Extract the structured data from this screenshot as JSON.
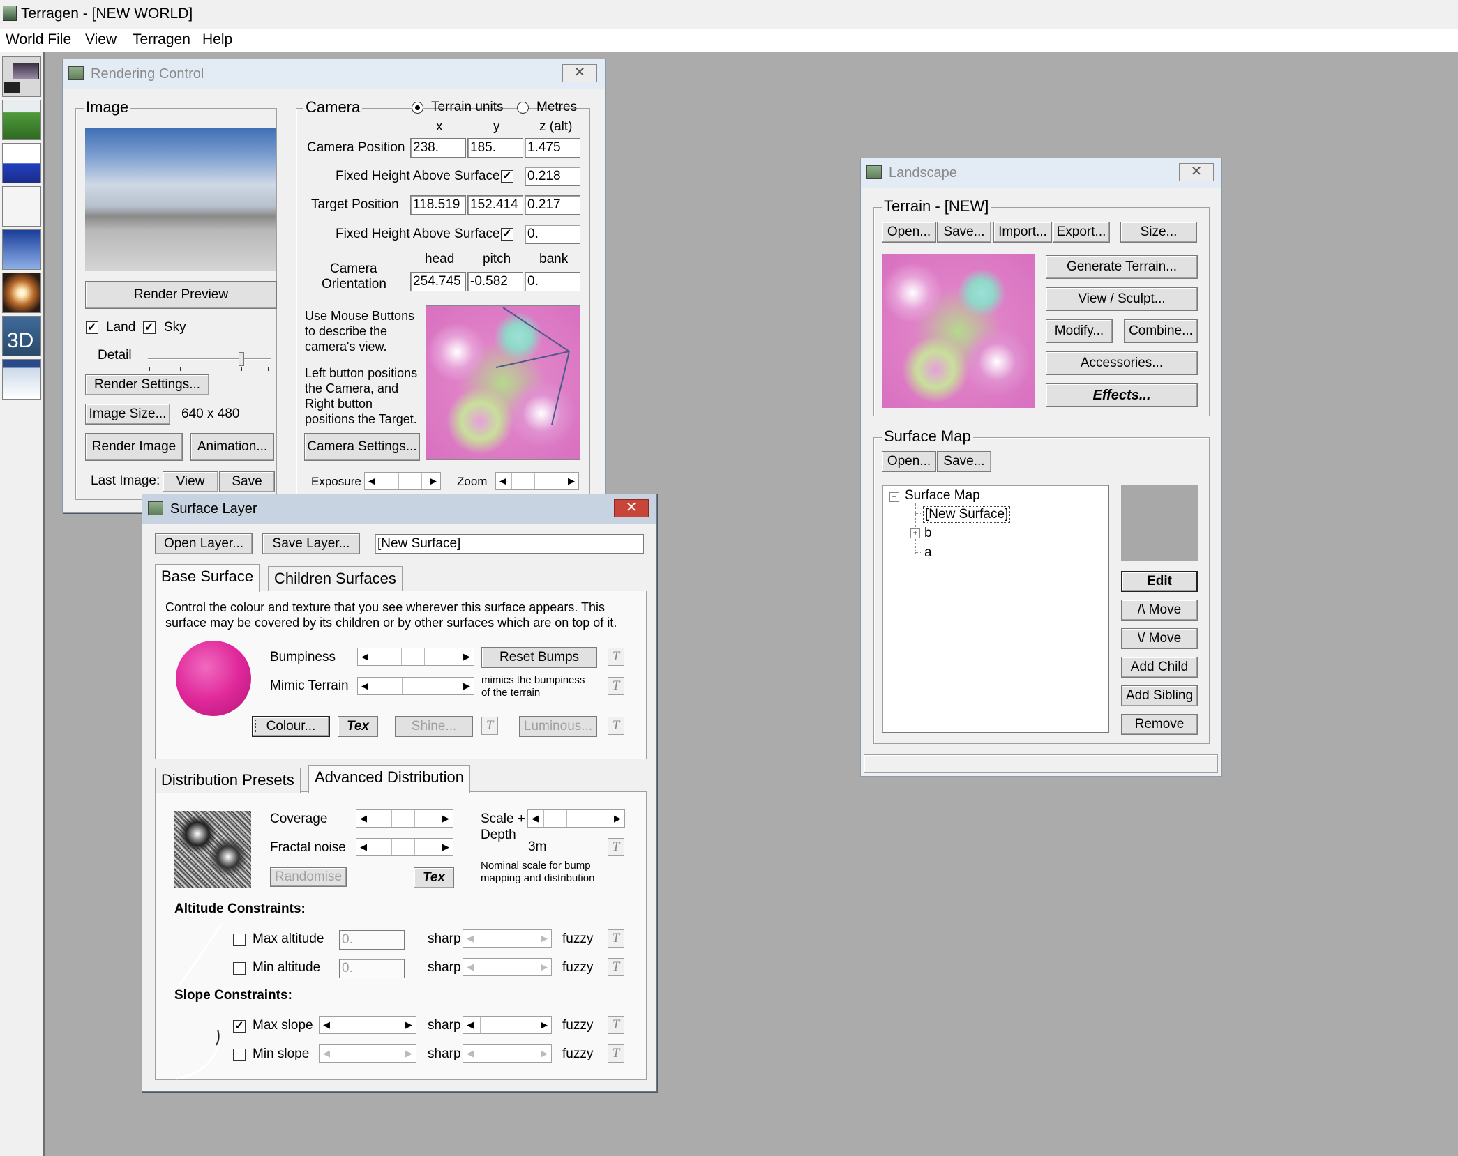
{
  "app": {
    "title": "Terragen  -  [NEW WORLD]"
  },
  "menu": [
    "World File",
    "View",
    "Terragen",
    "Help"
  ],
  "toolbar_icons": [
    "render-icon",
    "landscape-icon",
    "water-icon",
    "cloud-icon",
    "sky-icon",
    "sun-icon",
    "3d-icon",
    "image-icon"
  ],
  "rendering": {
    "title": "Rendering Control",
    "image_group": "Image",
    "render_preview": "Render Preview",
    "land": "Land",
    "sky": "Sky",
    "land_checked": true,
    "sky_checked": true,
    "detail": "Detail",
    "render_settings": "Render Settings...",
    "image_size": "Image Size...",
    "image_size_value": "640 x 480",
    "render_image": "Render Image",
    "animation": "Animation...",
    "last_image": "Last Image:",
    "view": "View",
    "save": "Save",
    "camera_group": "Camera",
    "terrain_units": "Terrain units",
    "metres": "Metres",
    "units_selected": "Terrain units",
    "col_x": "x",
    "col_y": "y",
    "col_z": "z (alt)",
    "camera_position": "Camera Position",
    "cam_x": "238.",
    "cam_y": "185.",
    "cam_z": "1.475",
    "fixed_height_1": "Fixed Height Above Surface",
    "fixed_height_1_value": "0.218",
    "target_position": "Target Position",
    "tgt_x": "118.519",
    "tgt_y": "152.414",
    "tgt_z": "0.217",
    "fixed_height_2": "Fixed Height Above Surface",
    "fixed_height_2_value": "0.",
    "head": "head",
    "pitch": "pitch",
    "bank": "bank",
    "camera_orientation_1": "Camera",
    "camera_orientation_2": "Orientation",
    "ori_head": "254.745",
    "ori_pitch": "-0.582",
    "ori_bank": "0.",
    "help1": [
      "Use Mouse Buttons",
      "to describe the",
      "camera's view."
    ],
    "help2": [
      "Left button positions",
      "the Camera, and",
      "Right button",
      "positions the Target."
    ],
    "camera_settings": "Camera Settings...",
    "exposure": "Exposure",
    "zoom": "Zoom"
  },
  "surface_layer": {
    "title": "Surface Layer",
    "open_layer": "Open Layer...",
    "save_layer": "Save Layer...",
    "name": "[New Surface]",
    "tab_base": "Base Surface",
    "tab_children": "Children Surfaces",
    "desc1": "Control the colour and texture that you see wherever this surface appears. This",
    "desc2": "surface may be covered by its children or by other surfaces which are on top of it.",
    "bumpiness": "Bumpiness",
    "reset_bumps": "Reset Bumps",
    "mimic_terrain": "Mimic Terrain",
    "mimic_note1": "mimics the bumpiness",
    "mimic_note2": "of the terrain",
    "colour": "Colour...",
    "tex": "Tex",
    "shine": "Shine...",
    "luminous": "Luminous...",
    "tab_presets": "Distribution Presets",
    "tab_advanced": "Advanced Distribution",
    "coverage": "Coverage",
    "fractal_noise": "Fractal noise",
    "scale_depth1": "Scale +",
    "scale_depth2": "Depth",
    "scale_value": "3m",
    "nominal1": "Nominal scale for bump",
    "nominal2": "mapping and distribution",
    "randomise": "Randomise",
    "tex2": "Tex",
    "altitude_constraints": "Altitude Constraints:",
    "max_altitude": "Max altitude",
    "max_altitude_value": "0.",
    "min_altitude": "Min altitude",
    "min_altitude_value": "0.",
    "slope_constraints": "Slope Constraints:",
    "max_slope": "Max slope",
    "min_slope": "Min slope",
    "max_slope_checked": true,
    "sharp": "sharp",
    "fuzzy": "fuzzy",
    "t": "T"
  },
  "landscape": {
    "title": "Landscape",
    "terrain_group": "Terrain - [NEW]",
    "open": "Open...",
    "save": "Save...",
    "import": "Import...",
    "export": "Export...",
    "size": "Size...",
    "generate": "Generate Terrain...",
    "view_sculpt": "View / Sculpt...",
    "modify": "Modify...",
    "combine": "Combine...",
    "accessories": "Accessories...",
    "effects": "Effects...",
    "surface_group": "Surface Map",
    "sm_open": "Open...",
    "sm_save": "Save...",
    "tree": {
      "root": "Surface Map",
      "items": [
        "[New Surface]",
        "b",
        "a"
      ]
    },
    "edit": "Edit",
    "move_up": "/\\ Move",
    "move_down": "\\/ Move",
    "add_child": "Add Child",
    "add_sibling": "Add Sibling",
    "remove": "Remove"
  }
}
